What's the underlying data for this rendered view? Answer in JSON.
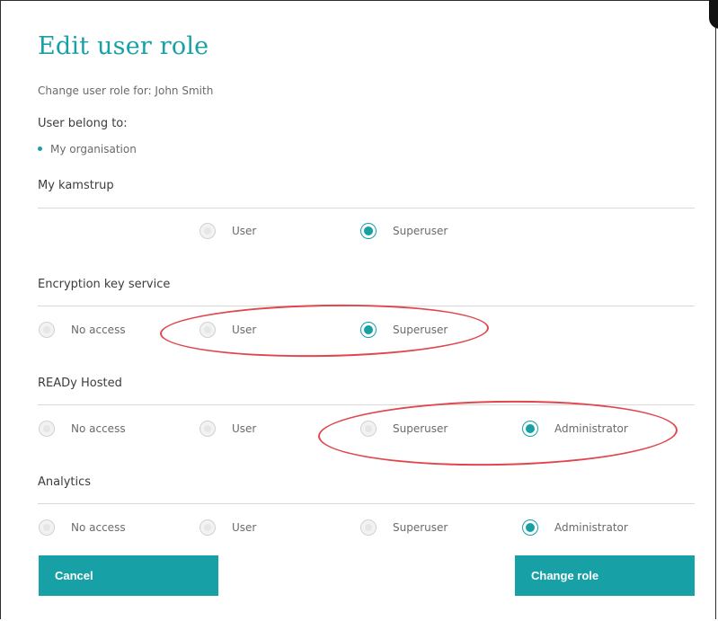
{
  "dialog": {
    "title": "Edit user role",
    "subtitle": "Change user role for: John Smith",
    "belong_label": "User belong to:",
    "organisations": [
      "My organisation"
    ]
  },
  "sections": [
    {
      "name": "My kamstrup",
      "options": [
        "User",
        "Superuser"
      ],
      "selected": "Superuser"
    },
    {
      "name": "Encryption key service",
      "options": [
        "No access",
        "User",
        "Superuser"
      ],
      "selected": "Superuser"
    },
    {
      "name": "READy Hosted",
      "options": [
        "No access",
        "User",
        "Superuser",
        "Administrator"
      ],
      "selected": "Administrator"
    },
    {
      "name": "Analytics",
      "options": [
        "No access",
        "User",
        "Superuser",
        "Administrator"
      ],
      "selected": "Administrator"
    }
  ],
  "buttons": {
    "cancel": "Cancel",
    "change_role": "Change role"
  },
  "colors": {
    "accent": "#17a0a5",
    "annotation": "#e0474c"
  }
}
